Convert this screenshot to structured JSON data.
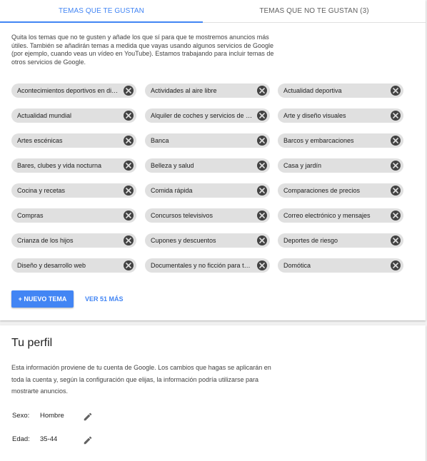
{
  "tabs": [
    {
      "label": "TEMAS QUE TE GUSTAN",
      "active": true
    },
    {
      "label": "TEMAS QUE NO TE GUSTAN (3)",
      "active": false
    }
  ],
  "intro": "Quita los temas que no te gusten y añade los que sí para que te mostremos anuncios más útiles. También se añadirán temas a medida que vayas usando algunos servicios de Google (por ejemplo, cuando veas un vídeo en YouTube). Estamos trabajando para incluir temas de otros servicios de Google.",
  "topics": [
    "Acontecimientos deportivos en directo",
    "Actividades al aire libre",
    "Actualidad deportiva",
    "Actualidad mundial",
    "Alquiler de coches y servicios de taxi",
    "Arte y diseño visuales",
    "Artes escénicas",
    "Banca",
    "Barcos y embarcaciones",
    "Bares, clubes y vida nocturna",
    "Belleza y salud",
    "Casa y jardín",
    "Cocina y recetas",
    "Comida rápida",
    "Comparaciones de precios",
    "Compras",
    "Concursos televisivos",
    "Correo electrónico y mensajes",
    "Crianza de los hijos",
    "Cupones y descuentos",
    "Deportes de riesgo",
    "Diseño y desarrollo web",
    "Documentales y no ficción para televisión",
    "Domótica"
  ],
  "actions": {
    "new_topic": "+ NUEVO TEMA",
    "see_more": "VER 51 MÁS"
  },
  "profile": {
    "title": "Tu perfil",
    "description": "Esta información proviene de tu cuenta de Google. Los cambios que hagas se aplicarán en toda la cuenta y, según la configuración que elijas, la información podría utilizarse para mostrarte anuncios.",
    "fields": [
      {
        "label": "Sexo:",
        "value": "Hombre",
        "icon": "pencil-icon"
      },
      {
        "label": "Edad:",
        "value": "35-44",
        "icon": "pencil-icon"
      }
    ]
  },
  "colors": {
    "accent": "#4285f4",
    "chip_bg": "#e0e0e0",
    "chip_remove": "#424242"
  }
}
